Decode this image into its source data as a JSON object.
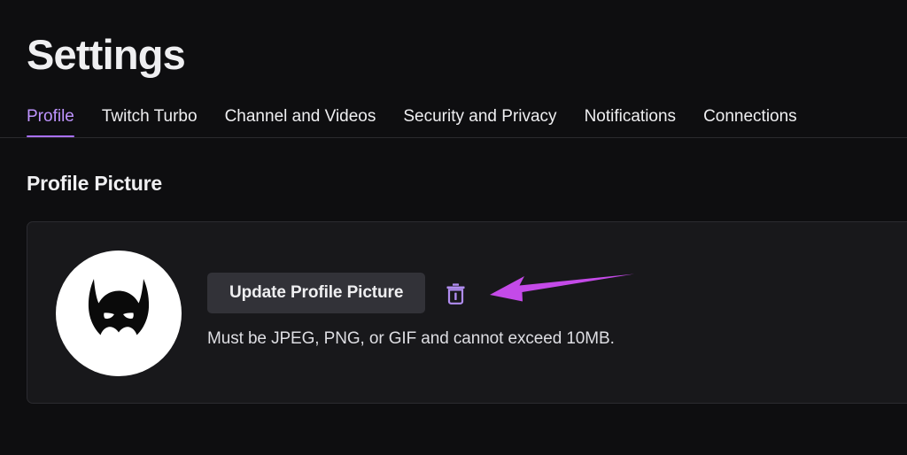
{
  "page": {
    "title": "Settings",
    "background_color": "#0e0e10"
  },
  "tabs": {
    "active_index": 0,
    "accent_color": "#a970ff",
    "items": [
      {
        "label": "Profile"
      },
      {
        "label": "Twitch Turbo"
      },
      {
        "label": "Channel and Videos"
      },
      {
        "label": "Security and Privacy"
      },
      {
        "label": "Notifications"
      },
      {
        "label": "Connections"
      }
    ]
  },
  "profile_picture_section": {
    "heading": "Profile Picture",
    "avatar": {
      "icon": "batman-mask-icon",
      "background_color": "#ffffff",
      "foreground_color": "#0a0a0a"
    },
    "update_button_label": "Update Profile Picture",
    "delete_button_icon": "trash-icon",
    "delete_button_color": "#b08cf0",
    "help_text": "Must be JPEG, PNG, or GIF and cannot exceed 10MB."
  },
  "annotation": {
    "arrow_icon": "left-arrow-annotation",
    "color": "#c44ae8",
    "points_to": "delete-profile-picture-button"
  }
}
